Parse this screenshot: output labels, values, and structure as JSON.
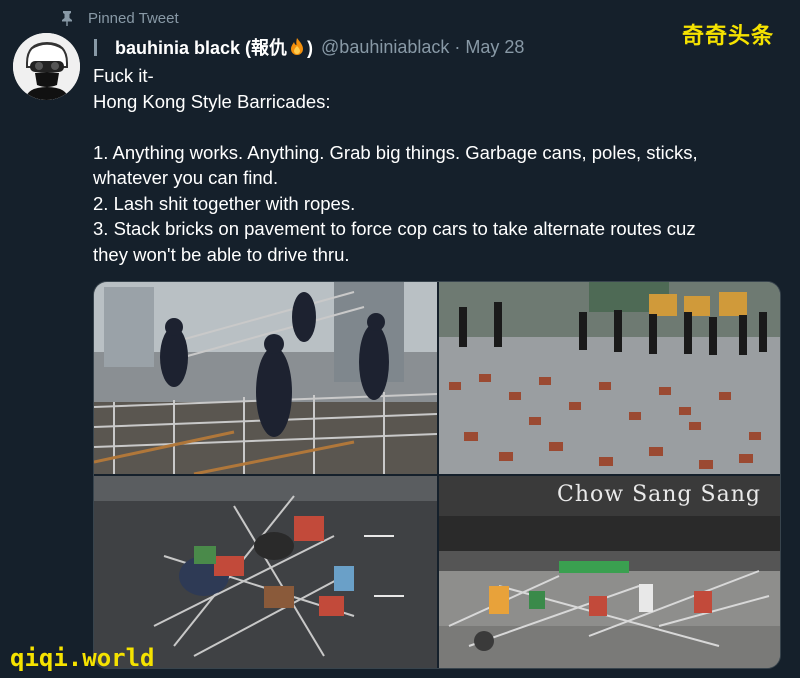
{
  "pinned": {
    "label": "Pinned Tweet",
    "icon": "pin-icon"
  },
  "author": {
    "display_name": "bauhinia black (報仇",
    "display_name_suffix": ")",
    "emoji": "fire",
    "handle": "@bauhiniablack",
    "separator": "·",
    "date": "May 28"
  },
  "watermarks": {
    "top": "奇奇头条",
    "bottom": "qiqi.world"
  },
  "tweet": {
    "lines": [
      "Fuck it-",
      "Hong Kong Style Barricades:",
      "",
      "1. Anything works. Anything. Grab big things. Garbage cans, poles, sticks,",
      "whatever you can find.",
      "2. Lash shit together with ropes.",
      "3. Stack bricks on pavement to force cop cars to take alternate routes cuz",
      "they won't be able to drive thru."
    ]
  },
  "media": {
    "photos": [
      {
        "subject": "police-with-metal-barriers"
      },
      {
        "subject": "bricks-stacked-on-road"
      },
      {
        "subject": "debris-barricade-on-street"
      },
      {
        "subject": "barricade-outside-store",
        "sign_text": "Chow Sang Sang"
      }
    ]
  },
  "colors": {
    "background": "#15202b",
    "text_primary": "#ffffff",
    "text_secondary": "#8899a6",
    "watermark": "#f5e200"
  }
}
